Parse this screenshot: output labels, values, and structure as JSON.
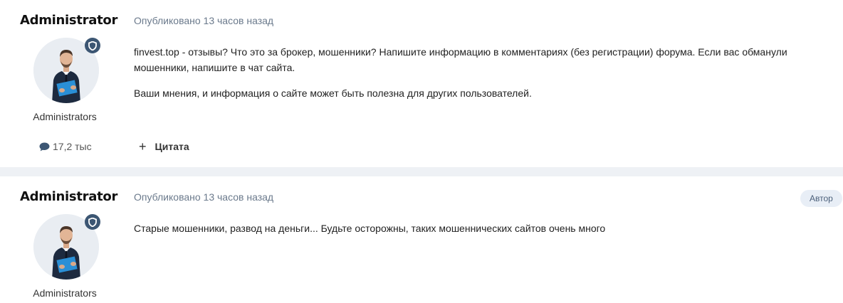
{
  "posts": [
    {
      "author": "Administrator",
      "group": "Administrators",
      "post_count": "17,2 тыс",
      "meta": "Опубликовано 13 часов назад",
      "paragraphs": [
        "finvest.top - отзывы? Что это за брокер, мошенники? Напишите информацию в комментариях (без регистрации) форума. Если вас обманули мошенники, напишите в чат сайта.",
        "Ваши мнения, и информация о сайте может быть полезна для других пользователей."
      ],
      "quote_label": "Цитата",
      "quote_icon": "+"
    },
    {
      "author": "Administrator",
      "group": "Administrators",
      "meta": "Опубликовано 13 часов назад",
      "author_badge": "Автор",
      "paragraphs": [
        "Старые мошенники, развод на деньги... Будьте осторожны, таких мошеннических сайтов очень много"
      ]
    }
  ],
  "icons": {
    "avatar": "avatar-businessman",
    "badge": "shield-icon",
    "post_count": "speech-bubble-icon"
  },
  "colors": {
    "separator": "#eef1f5",
    "badge": "#3c5673",
    "meta_text": "#6b7a8c",
    "author_badge_bg": "#e8eef6"
  }
}
